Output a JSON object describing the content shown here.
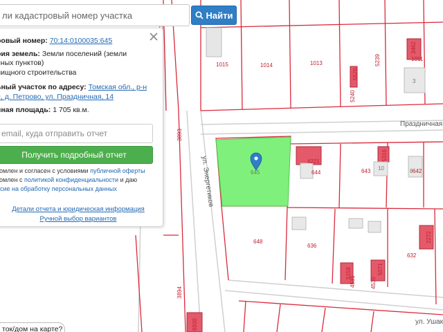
{
  "search": {
    "placeholder": "ли кадастровый номер участка",
    "button_label": "Найти"
  },
  "panel": {
    "cadastral_label": "ровый номер:",
    "cadastral_value": "70:14:0100035:645",
    "category_label": "рия земель:",
    "category_value_1": "Земли поселений (земли",
    "category_value_2": "нных пунктов)",
    "category_value_3": "лищного строительства",
    "address_label": "ьный участок по адресу:",
    "address_link_1": "Томская обл., р-н",
    "address_link_2": "й, д. Петрово, ул. Праздничная, 14",
    "area_label": "нная площадь:",
    "area_value": "1 705 кв.м.",
    "email_placeholder": "email, куда отправить отчет",
    "report_button": "Получить подробный отчет",
    "terms_1_prefix": "комлен и согласен с условиями ",
    "terms_1_link": "публичной оферты",
    "terms_2_prefix": "комлен с ",
    "terms_2_link": "политикой конфиденциальности",
    "terms_2_suffix": " и даю",
    "terms_3_link": "асие на обработку персональных данных",
    "details_link": "Детали отчета и юридическая информация",
    "manual_link": "Ручной выбор вариантов"
  },
  "help_text": "ток/дом на карте?",
  "map": {
    "colors": {
      "boundary": "#d9283a",
      "road": "#c9c9c9",
      "highlight": "#7ff07c",
      "highlight_stroke": "#4ec84b",
      "building": "#e8e8e8",
      "building_red": "#e45a6a",
      "marker": "#2f7ec6"
    },
    "parcel_labels": [
      "1015",
      "1014",
      "1013",
      "1011",
      "3",
      "5240",
      "5576",
      "5239",
      "3462",
      "645",
      "644",
      "643",
      "642",
      "10",
      "8",
      "4221",
      "5316",
      "648",
      "636",
      "632",
      "2272",
      "5158",
      "4531",
      "5071",
      "4530",
      "3893",
      "3894",
      "6930",
      "2092"
    ],
    "street_labels": [
      "Праздничная",
      "ул. Энергетиков",
      "ул. Ушако"
    ],
    "marker_icon": "map-pin-icon"
  }
}
